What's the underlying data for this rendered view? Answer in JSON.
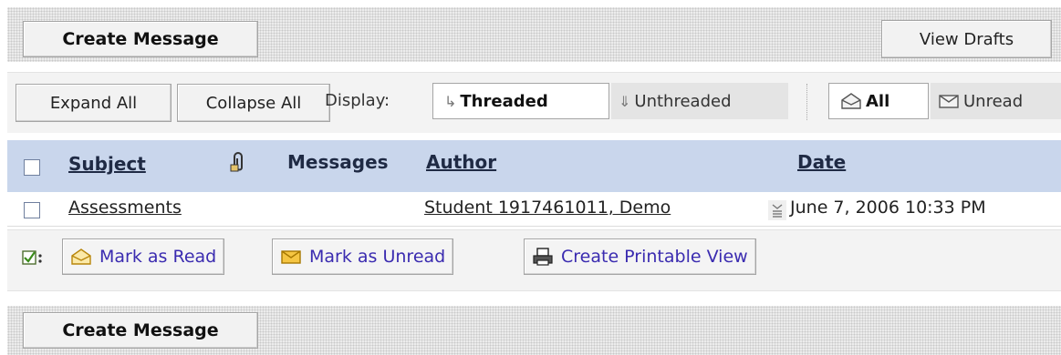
{
  "top": {
    "create_message": "Create Message",
    "view_drafts": "View Drafts"
  },
  "toolbar": {
    "expand_all": "Expand All",
    "collapse_all": "Collapse All",
    "display_label": "Display:",
    "threaded": "Threaded",
    "unthreaded": "Unthreaded",
    "filter_all": "All",
    "filter_unread": "Unread"
  },
  "table": {
    "headers": {
      "subject": "Subject",
      "messages": "Messages",
      "author": "Author",
      "date": "Date"
    },
    "rows": [
      {
        "subject": "Assessments",
        "author": "Student 1917461011, Demo",
        "date": "June 7, 2006 10:33 PM"
      }
    ]
  },
  "actions": {
    "mark_read": "Mark as Read",
    "mark_unread": "Mark as Unread",
    "printable": "Create Printable View"
  },
  "bottom": {
    "create_message": "Create Message"
  },
  "icons": {
    "threaded": "threaded-arrow-icon",
    "unthreaded": "down-arrow-icon",
    "all": "open-envelope-icon",
    "unread": "closed-envelope-icon",
    "attachment": "paperclip-icon",
    "author_menu": "menu-icon",
    "select_all": "checkmark-icon",
    "mark_read": "open-envelope-icon",
    "mark_unread": "closed-envelope-icon",
    "print": "printer-icon"
  },
  "colors": {
    "header_bg": "#c9d6ec",
    "action_text": "#3a2bb0"
  }
}
